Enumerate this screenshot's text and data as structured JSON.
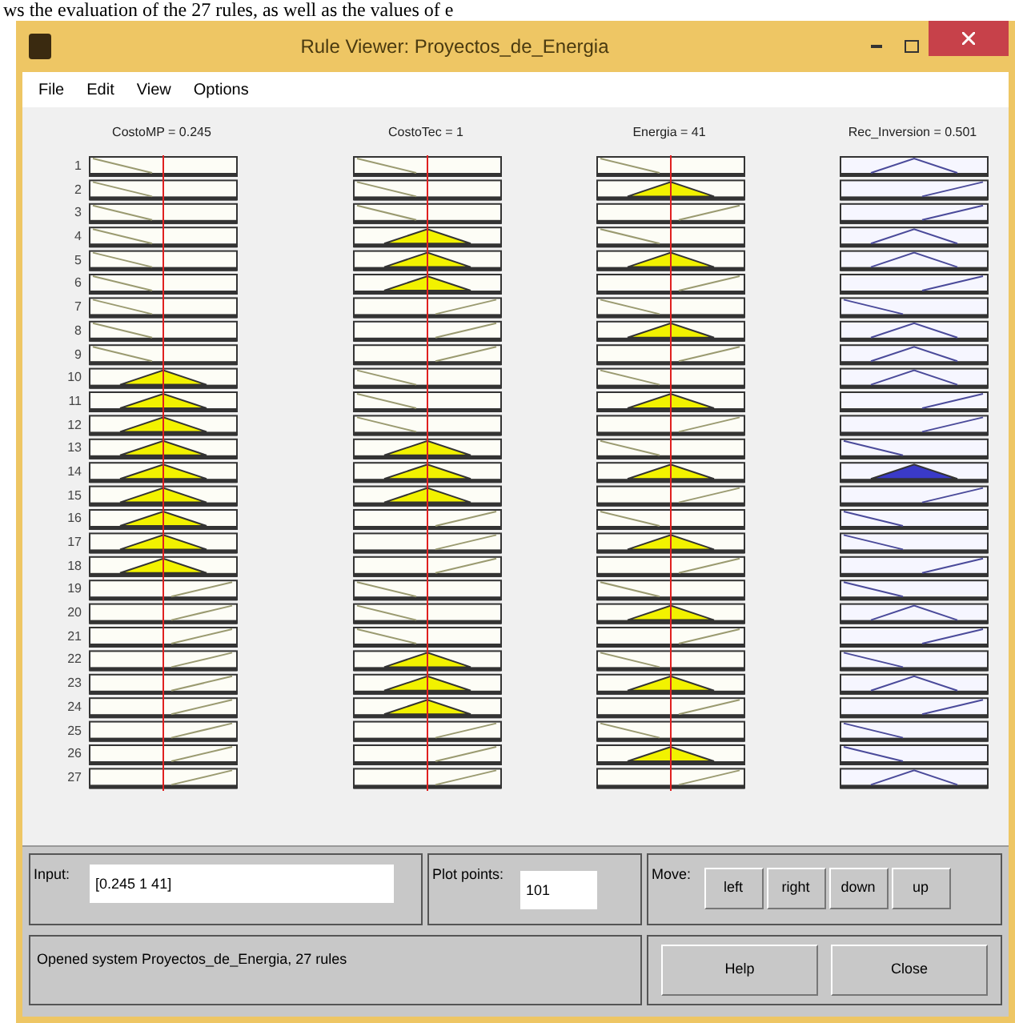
{
  "caption": "ws the evaluation of the 27 rules, as well as the values of e",
  "window": {
    "title": "Rule Viewer: Proyectos_de_Energia"
  },
  "menu": [
    "File",
    "Edit",
    "View",
    "Options"
  ],
  "rule_numbers": [
    "1",
    "2",
    "3",
    "4",
    "5",
    "6",
    "7",
    "8",
    "9",
    "10",
    "11",
    "12",
    "13",
    "14",
    "15",
    "16",
    "17",
    "18",
    "19",
    "20",
    "21",
    "22",
    "23",
    "24",
    "25",
    "26",
    "27"
  ],
  "variables": [
    {
      "label": "CostoMP = 0.245",
      "kind": "input",
      "rules": [
        {
          "kind": "low",
          "fired": false
        },
        {
          "kind": "low",
          "fired": false
        },
        {
          "kind": "low",
          "fired": false
        },
        {
          "kind": "low",
          "fired": false
        },
        {
          "kind": "low",
          "fired": false
        },
        {
          "kind": "low",
          "fired": false
        },
        {
          "kind": "low",
          "fired": false
        },
        {
          "kind": "low",
          "fired": false
        },
        {
          "kind": "low",
          "fired": false
        },
        {
          "kind": "mid",
          "fired": true
        },
        {
          "kind": "mid",
          "fired": true
        },
        {
          "kind": "mid",
          "fired": true
        },
        {
          "kind": "mid",
          "fired": true
        },
        {
          "kind": "mid",
          "fired": true
        },
        {
          "kind": "mid",
          "fired": true
        },
        {
          "kind": "mid",
          "fired": true
        },
        {
          "kind": "mid",
          "fired": true
        },
        {
          "kind": "mid",
          "fired": true
        },
        {
          "kind": "high",
          "fired": false
        },
        {
          "kind": "high",
          "fired": false
        },
        {
          "kind": "high",
          "fired": false
        },
        {
          "kind": "high",
          "fired": false
        },
        {
          "kind": "high",
          "fired": false
        },
        {
          "kind": "high",
          "fired": false
        },
        {
          "kind": "high",
          "fired": false
        },
        {
          "kind": "high",
          "fired": false
        },
        {
          "kind": "high",
          "fired": false
        }
      ]
    },
    {
      "label": "CostoTec = 1",
      "kind": "input",
      "rules": [
        {
          "kind": "low",
          "fired": false
        },
        {
          "kind": "low",
          "fired": false
        },
        {
          "kind": "low",
          "fired": false
        },
        {
          "kind": "mid",
          "fired": true
        },
        {
          "kind": "mid",
          "fired": true
        },
        {
          "kind": "mid",
          "fired": true
        },
        {
          "kind": "high",
          "fired": false
        },
        {
          "kind": "high",
          "fired": false
        },
        {
          "kind": "high",
          "fired": false
        },
        {
          "kind": "low",
          "fired": false
        },
        {
          "kind": "low",
          "fired": false
        },
        {
          "kind": "low",
          "fired": false
        },
        {
          "kind": "mid",
          "fired": true
        },
        {
          "kind": "mid",
          "fired": true
        },
        {
          "kind": "mid",
          "fired": true
        },
        {
          "kind": "high",
          "fired": false
        },
        {
          "kind": "high",
          "fired": false
        },
        {
          "kind": "high",
          "fired": false
        },
        {
          "kind": "low",
          "fired": false
        },
        {
          "kind": "low",
          "fired": false
        },
        {
          "kind": "low",
          "fired": false
        },
        {
          "kind": "mid",
          "fired": true
        },
        {
          "kind": "mid",
          "fired": true
        },
        {
          "kind": "mid",
          "fired": true
        },
        {
          "kind": "high",
          "fired": false
        },
        {
          "kind": "high",
          "fired": false
        },
        {
          "kind": "high",
          "fired": false
        }
      ]
    },
    {
      "label": "Energia = 41",
      "kind": "input",
      "rules": [
        {
          "kind": "low",
          "fired": false
        },
        {
          "kind": "mid",
          "fired": true
        },
        {
          "kind": "high",
          "fired": false
        },
        {
          "kind": "low",
          "fired": false
        },
        {
          "kind": "mid",
          "fired": true
        },
        {
          "kind": "high",
          "fired": false
        },
        {
          "kind": "low",
          "fired": false
        },
        {
          "kind": "mid",
          "fired": true
        },
        {
          "kind": "high",
          "fired": false
        },
        {
          "kind": "low",
          "fired": false
        },
        {
          "kind": "mid",
          "fired": true
        },
        {
          "kind": "high",
          "fired": false
        },
        {
          "kind": "low",
          "fired": false
        },
        {
          "kind": "mid",
          "fired": true
        },
        {
          "kind": "high",
          "fired": false
        },
        {
          "kind": "low",
          "fired": false
        },
        {
          "kind": "mid",
          "fired": true
        },
        {
          "kind": "high",
          "fired": false
        },
        {
          "kind": "low",
          "fired": false
        },
        {
          "kind": "mid",
          "fired": true
        },
        {
          "kind": "high",
          "fired": false
        },
        {
          "kind": "low",
          "fired": false
        },
        {
          "kind": "mid",
          "fired": true
        },
        {
          "kind": "high",
          "fired": false
        },
        {
          "kind": "low",
          "fired": false
        },
        {
          "kind": "mid",
          "fired": true
        },
        {
          "kind": "high",
          "fired": false
        }
      ]
    },
    {
      "label": "Rec_Inversion = 0.501",
      "kind": "output",
      "rules": [
        {
          "kind": "mid",
          "fired": false
        },
        {
          "kind": "high",
          "fired": false
        },
        {
          "kind": "high",
          "fired": false
        },
        {
          "kind": "mid",
          "fired": false
        },
        {
          "kind": "mid",
          "fired": false
        },
        {
          "kind": "high",
          "fired": false
        },
        {
          "kind": "low",
          "fired": false
        },
        {
          "kind": "mid",
          "fired": false
        },
        {
          "kind": "mid",
          "fired": false
        },
        {
          "kind": "mid",
          "fired": false
        },
        {
          "kind": "high",
          "fired": false
        },
        {
          "kind": "high",
          "fired": false
        },
        {
          "kind": "low",
          "fired": false
        },
        {
          "kind": "mid",
          "fired": true
        },
        {
          "kind": "high",
          "fired": false
        },
        {
          "kind": "low",
          "fired": false
        },
        {
          "kind": "low",
          "fired": false
        },
        {
          "kind": "high",
          "fired": false
        },
        {
          "kind": "low",
          "fired": false
        },
        {
          "kind": "mid",
          "fired": false
        },
        {
          "kind": "high",
          "fired": false
        },
        {
          "kind": "low",
          "fired": false
        },
        {
          "kind": "mid",
          "fired": false
        },
        {
          "kind": "high",
          "fired": false
        },
        {
          "kind": "low",
          "fired": false
        },
        {
          "kind": "low",
          "fired": false
        },
        {
          "kind": "mid",
          "fired": false
        }
      ]
    }
  ],
  "input": {
    "label": "Input:",
    "value": "[0.245 1 41]"
  },
  "plot_points": {
    "label": "Plot points:",
    "value": "101"
  },
  "move": {
    "label": "Move:",
    "buttons": [
      "left",
      "right",
      "down",
      "up"
    ]
  },
  "status": "Opened system Proyectos_de_Energia, 27 rules",
  "buttons": [
    "Help",
    "Close"
  ]
}
